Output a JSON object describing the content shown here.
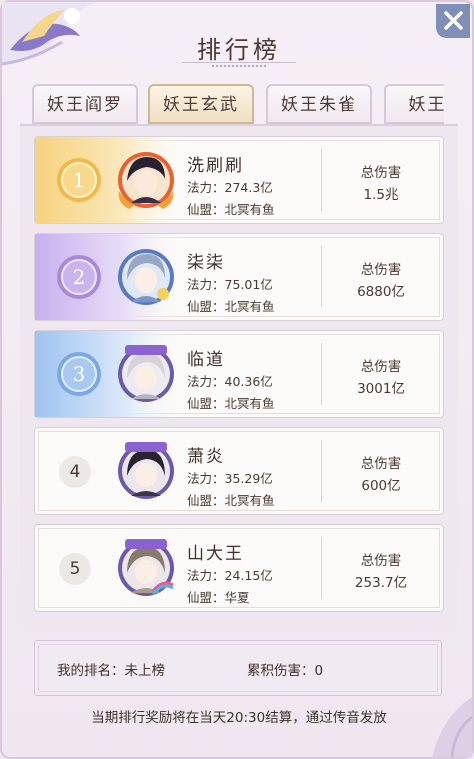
{
  "header": {
    "title": "排行榜"
  },
  "tabs": [
    {
      "label": "妖王阎罗",
      "active": false
    },
    {
      "label": "妖王玄武",
      "active": true
    },
    {
      "label": "妖王朱雀",
      "active": false
    },
    {
      "label": "妖王饕",
      "active": false
    }
  ],
  "ranking": [
    {
      "rank": "1",
      "name": "洗刷刷",
      "power": "法力：274.3亿",
      "guild": "仙盟：北冥有鱼",
      "damage_label": "总伤害",
      "damage": "1.5兆",
      "theme": "gold"
    },
    {
      "rank": "2",
      "name": "柒柒",
      "power": "法力：75.01亿",
      "guild": "仙盟：北冥有鱼",
      "damage_label": "总伤害",
      "damage": "6880亿",
      "theme": "purple"
    },
    {
      "rank": "3",
      "name": "临道",
      "power": "法力：40.36亿",
      "guild": "仙盟：北冥有鱼",
      "damage_label": "总伤害",
      "damage": "3001亿",
      "theme": "blue"
    },
    {
      "rank": "4",
      "name": "萧炎",
      "power": "法力：35.29亿",
      "guild": "仙盟：北冥有鱼",
      "damage_label": "总伤害",
      "damage": "600亿",
      "theme": "plain"
    },
    {
      "rank": "5",
      "name": "山大王",
      "power": "法力：24.15亿",
      "guild": "仙盟：华夏",
      "damage_label": "总伤害",
      "damage": "253.7亿",
      "theme": "plain"
    }
  ],
  "footer": {
    "my_rank": "我的排名：未上榜",
    "cumulative_damage": "累积伤害：0",
    "notice": "当期排行奖励将在当天20:30结算，通过传音发放"
  },
  "colors": {
    "gold": "#f4c45a",
    "purple": "#b69be0",
    "blue": "#8fb6ec",
    "text": "#4a3a33"
  }
}
